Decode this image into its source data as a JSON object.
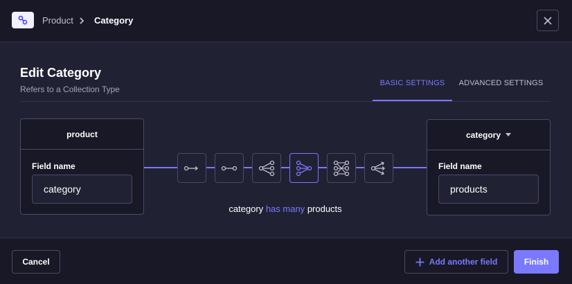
{
  "header": {
    "breadcrumb": [
      "Product",
      "Category"
    ],
    "logo_icon": "relation-link-icon",
    "close_icon": "close-icon"
  },
  "modal": {
    "title": "Edit Category",
    "subtitle": "Refers to a Collection Type"
  },
  "tabs": [
    {
      "label": "BASIC SETTINGS",
      "active": true
    },
    {
      "label": "ADVANCED SETTINGS",
      "active": false
    }
  ],
  "left_card": {
    "header": "product",
    "field_label": "Field name",
    "field_value": "category"
  },
  "right_card": {
    "header": "category",
    "field_label": "Field name",
    "field_value": "products"
  },
  "relation_types": [
    {
      "icon": "one-way-icon",
      "active": false
    },
    {
      "icon": "one-to-one-icon",
      "active": false
    },
    {
      "icon": "one-to-many-icon",
      "active": false
    },
    {
      "icon": "many-to-one-icon",
      "active": true
    },
    {
      "icon": "many-to-many-icon",
      "active": false
    },
    {
      "icon": "many-way-icon",
      "active": false
    }
  ],
  "sentence": {
    "left": "category",
    "middle": "has many",
    "right": "products"
  },
  "footer": {
    "cancel_label": "Cancel",
    "add_label": "Add another field",
    "finish_label": "Finish"
  },
  "colors": {
    "accent": "#7b79ff",
    "background": "#212134",
    "surface": "#181826",
    "border": "#4a4a6a"
  }
}
